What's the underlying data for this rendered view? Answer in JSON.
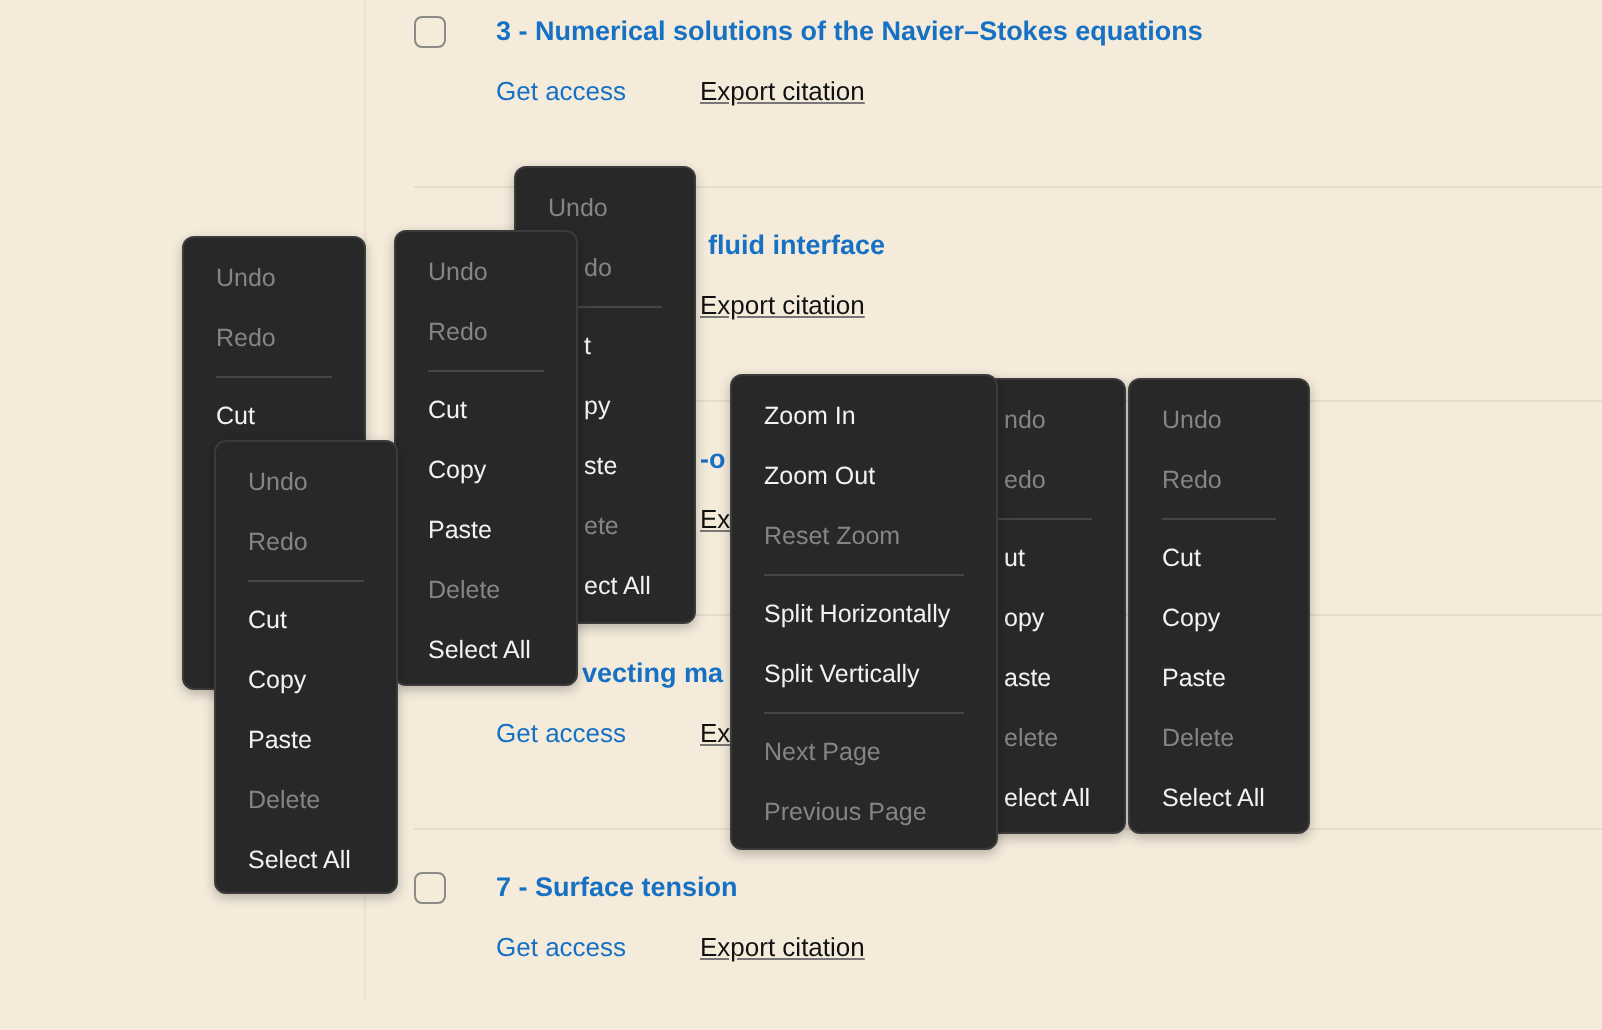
{
  "chapters": [
    {
      "checkbox": {
        "checked": false
      },
      "title": "3 - Numerical solutions of the Navier–Stokes equations",
      "links": [
        {
          "kind": "access",
          "text": "Get access"
        },
        {
          "kind": "citation",
          "text": "Export citation"
        }
      ]
    },
    {
      "title": "fluid interface",
      "links": [
        {
          "kind": "citation",
          "text": "Export citation"
        }
      ]
    },
    {
      "title": "-o",
      "links": [
        {
          "kind": "citation",
          "text": "Ex"
        }
      ]
    },
    {
      "title": "vecting ma",
      "links": [
        {
          "kind": "access",
          "text": "Get access"
        },
        {
          "kind": "citation",
          "text": "Ex"
        }
      ]
    },
    {
      "checkbox": {
        "checked": false
      },
      "title": "7 - Surface tension",
      "links": [
        {
          "kind": "access",
          "text": "Get access"
        },
        {
          "kind": "citation",
          "text": "Export citation"
        }
      ]
    }
  ],
  "context_menus": [
    {
      "groups": [
        [
          {
            "label": "Undo",
            "disabled": true
          },
          {
            "label": "Redo",
            "disabled": true
          }
        ],
        [
          {
            "label": "Cut",
            "disabled": false
          }
        ]
      ]
    },
    {
      "groups": [
        [
          {
            "label": "Undo",
            "disabled": true
          },
          {
            "label": "do",
            "disabled": true
          }
        ],
        [
          {
            "label": "t",
            "disabled": false
          },
          {
            "label": "py",
            "disabled": false
          },
          {
            "label": "ste",
            "disabled": false
          },
          {
            "label": "ete",
            "disabled": true
          },
          {
            "label": "ect All",
            "disabled": false
          }
        ]
      ]
    },
    {
      "groups": [
        [
          {
            "label": "Undo",
            "disabled": true
          },
          {
            "label": "Redo",
            "disabled": true
          }
        ],
        [
          {
            "label": "Cut",
            "disabled": false
          },
          {
            "label": "Copy",
            "disabled": false
          },
          {
            "label": "Paste",
            "disabled": false
          },
          {
            "label": "Delete",
            "disabled": true
          },
          {
            "label": "Select All",
            "disabled": false
          }
        ]
      ]
    },
    {
      "groups": [
        [
          {
            "label": "Undo",
            "disabled": true
          },
          {
            "label": "Redo",
            "disabled": true
          }
        ],
        [
          {
            "label": "Cut",
            "disabled": false
          },
          {
            "label": "Copy",
            "disabled": false
          },
          {
            "label": "Paste",
            "disabled": false
          },
          {
            "label": "Delete",
            "disabled": true
          },
          {
            "label": "Select All",
            "disabled": false
          }
        ]
      ]
    },
    {
      "groups": [
        [
          {
            "label": "Zoom In",
            "disabled": false
          },
          {
            "label": "Zoom Out",
            "disabled": false
          },
          {
            "label": "Reset Zoom",
            "disabled": true
          }
        ],
        [
          {
            "label": "Split Horizontally",
            "disabled": false
          },
          {
            "label": "Split Vertically",
            "disabled": false
          }
        ],
        [
          {
            "label": "Next Page",
            "disabled": true
          },
          {
            "label": "Previous Page",
            "disabled": true
          }
        ]
      ]
    },
    {
      "groups": [
        [
          {
            "label": "ndo",
            "disabled": true
          },
          {
            "label": "edo",
            "disabled": true
          }
        ],
        [
          {
            "label": "ut",
            "disabled": false
          },
          {
            "label": "opy",
            "disabled": false
          },
          {
            "label": "aste",
            "disabled": false
          },
          {
            "label": "elete",
            "disabled": true
          },
          {
            "label": "elect All",
            "disabled": false
          }
        ]
      ]
    },
    {
      "groups": [
        [
          {
            "label": "Undo",
            "disabled": true
          },
          {
            "label": "Redo",
            "disabled": true
          }
        ],
        [
          {
            "label": "Cut",
            "disabled": false
          },
          {
            "label": "Copy",
            "disabled": false
          },
          {
            "label": "Paste",
            "disabled": false
          },
          {
            "label": "Delete",
            "disabled": true
          },
          {
            "label": "Select All",
            "disabled": false
          }
        ]
      ]
    }
  ]
}
